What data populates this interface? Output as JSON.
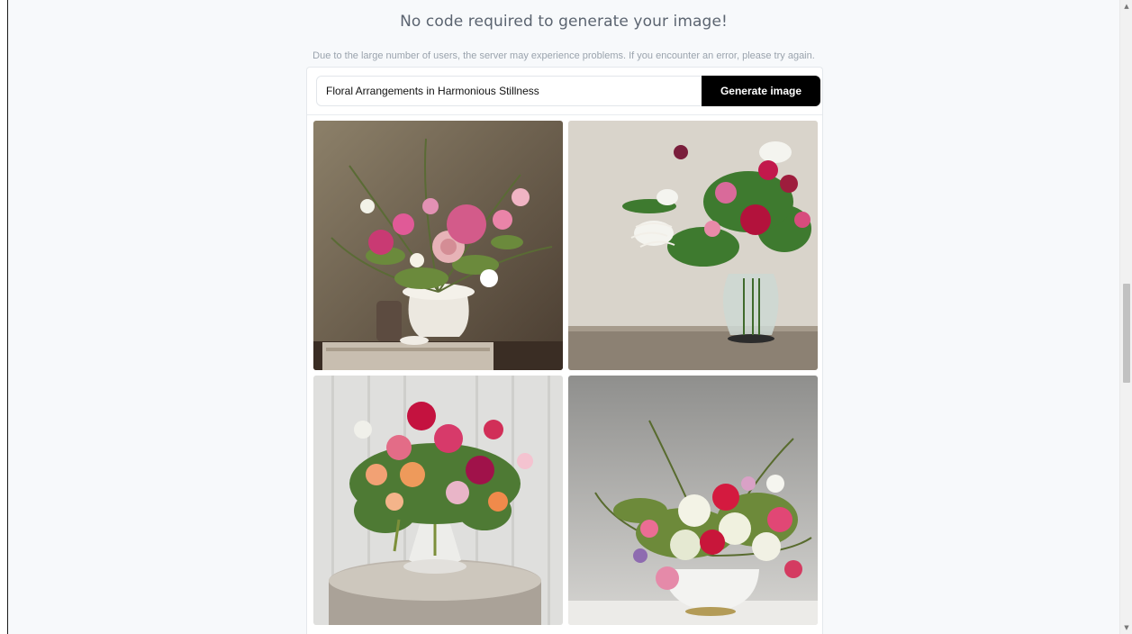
{
  "headline": "No code required to generate your image!",
  "notice": "Due to the large number of users, the server may experience problems. If you encounter an error, please try again.",
  "prompt": {
    "value": "Floral Arrangements in Harmonious Stillness"
  },
  "generate_button": {
    "label": "Generate image"
  },
  "colors": {
    "button_bg": "#000000",
    "page_bg": "#f7f9fb",
    "headline": "#5b6470",
    "notice": "#9aa3ad"
  },
  "scrollbar": {
    "up_icon": "triangle-up",
    "down_icon": "triangle-down"
  }
}
